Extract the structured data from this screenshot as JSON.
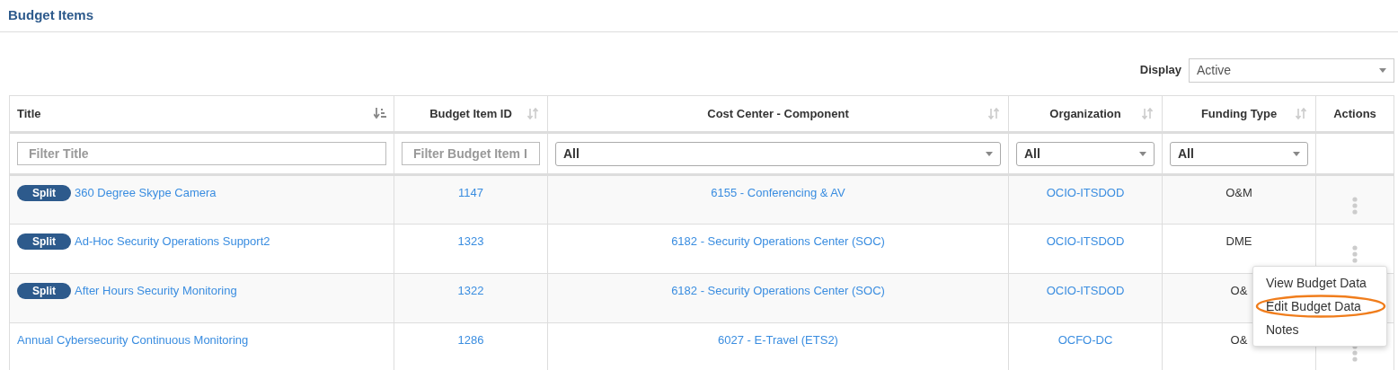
{
  "page": {
    "title": "Budget Items"
  },
  "display": {
    "label": "Display",
    "value": "Active"
  },
  "table": {
    "columns": [
      {
        "label": "Title",
        "sorted": true,
        "filter": {
          "kind": "text",
          "placeholder": "Filter Title"
        }
      },
      {
        "label": "Budget Item ID",
        "sorted": false,
        "filter": {
          "kind": "text",
          "placeholder": "Filter Budget Item I"
        }
      },
      {
        "label": "Cost Center - Component",
        "sorted": false,
        "filter": {
          "kind": "select",
          "value": "All"
        }
      },
      {
        "label": "Organization",
        "sorted": false,
        "filter": {
          "kind": "select",
          "value": "All"
        }
      },
      {
        "label": "Funding Type",
        "sorted": false,
        "filter": {
          "kind": "select",
          "value": "All"
        }
      },
      {
        "label": "Actions"
      }
    ],
    "rows": [
      {
        "badge": "Split",
        "title": "360 Degree Skype Camera",
        "id": "1147",
        "cost_center": "6155 - Conferencing & AV",
        "organization": "OCIO-ITSDOD",
        "funding_type": "O&M",
        "actions_visible": true
      },
      {
        "badge": "Split",
        "title": "Ad-Hoc Security Operations Support2",
        "id": "1323",
        "cost_center": "6182 - Security Operations Center (SOC)",
        "organization": "OCIO-ITSDOD",
        "funding_type": "DME",
        "actions_visible": true
      },
      {
        "badge": "Split",
        "title": "After Hours Security Monitoring",
        "id": "1322",
        "cost_center": "6182 - Security Operations Center (SOC)",
        "organization": "OCIO-ITSDOD",
        "funding_type": "O&",
        "actions_visible": false
      },
      {
        "title": "Annual Cybersecurity Continuous Monitoring",
        "id": "1286",
        "cost_center": "6027 - E-Travel (ETS2)",
        "organization": "OCFO-DC",
        "funding_type": "O&",
        "actions_visible": true
      }
    ]
  },
  "action_menu": {
    "items": [
      {
        "label": "View Budget Data",
        "highlighted": false
      },
      {
        "label": "Edit Budget Data",
        "highlighted": true
      },
      {
        "label": "Notes",
        "highlighted": false
      }
    ]
  }
}
